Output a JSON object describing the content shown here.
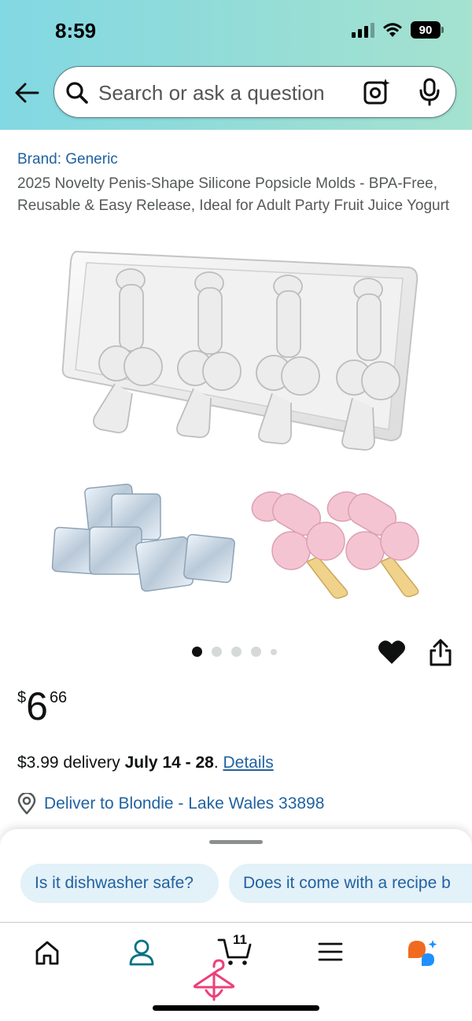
{
  "status_bar": {
    "time": "8:59",
    "battery": "90"
  },
  "search": {
    "placeholder": "Search or ask a question"
  },
  "product": {
    "brand": "Brand: Generic",
    "title": "2025 Novelty Penis-Shape Silicone Popsicle Molds - BPA-Free, Reusable & Easy Release, Ideal for Adult Party Fruit Juice Yogurt",
    "image_count": 5,
    "active_image": 1,
    "price_symbol": "$",
    "price_whole": "6",
    "price_fraction": "66"
  },
  "delivery": {
    "fee": "$3.99 delivery ",
    "dates": "July 14 - 28",
    "period": ". ",
    "details_link": "Details"
  },
  "deliver_to": {
    "label": "Deliver to Blondie - Lake Wales 33898"
  },
  "suggestions": [
    {
      "label": "Is it dishwasher safe?"
    },
    {
      "label": "Does it come with a recipe b"
    }
  ],
  "nav": {
    "cart_count": "11"
  },
  "colors": {
    "link": "#2162a1",
    "header_gradient_start": "#82d8e3",
    "header_gradient_end": "#a5e2cf",
    "chip_bg": "#e3f1f8",
    "rufus_orange": "#f06a1f",
    "rufus_blue": "#1e90ff",
    "hanger_pink": "#ec407a"
  }
}
